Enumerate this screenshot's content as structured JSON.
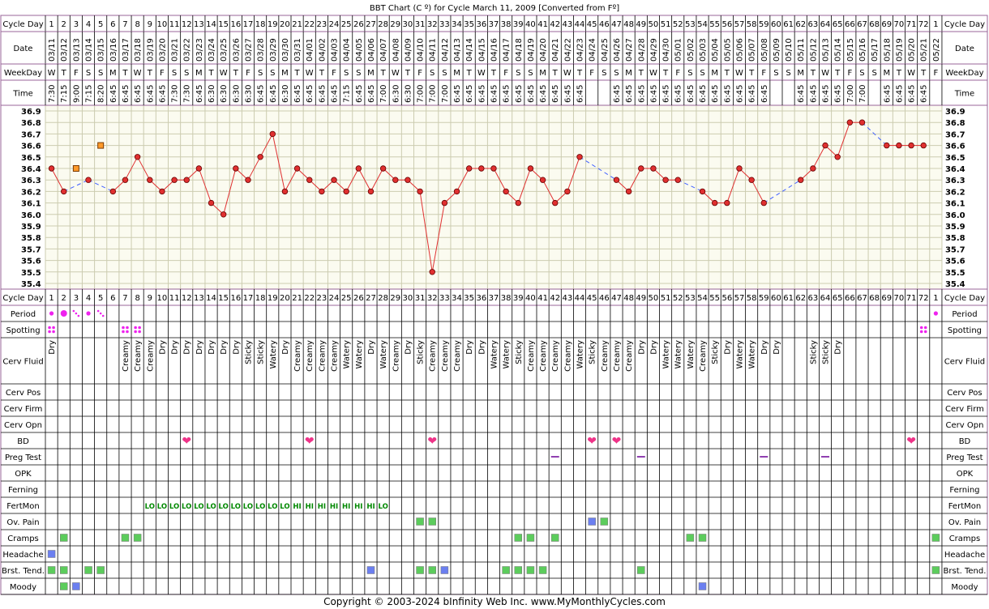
{
  "chart_data": {
    "type": "line",
    "title": "BBT Chart (C º) for Cycle March 11, 2009  [Converted from Fº]",
    "ylim": [
      35.4,
      36.9
    ],
    "yticks": [
      "36.9",
      "36.8",
      "36.7",
      "36.6",
      "36.5",
      "36.4",
      "36.3",
      "36.2",
      "36.1",
      "36.0",
      "35.9",
      "35.8",
      "35.7",
      "35.6",
      "35.5",
      "35.4"
    ],
    "row_labels": {
      "cycle_day": "Cycle Day",
      "date": "Date",
      "weekday": "WeekDay",
      "time": "Time"
    },
    "cycle_days": [
      "1",
      "2",
      "3",
      "4",
      "5",
      "6",
      "7",
      "8",
      "9",
      "10",
      "11",
      "12",
      "13",
      "14",
      "15",
      "16",
      "17",
      "18",
      "19",
      "20",
      "21",
      "22",
      "23",
      "24",
      "25",
      "26",
      "27",
      "28",
      "29",
      "30",
      "31",
      "32",
      "33",
      "34",
      "35",
      "36",
      "37",
      "38",
      "39",
      "40",
      "41",
      "42",
      "43",
      "44",
      "45",
      "46",
      "47",
      "48",
      "49",
      "50",
      "51",
      "52",
      "53",
      "54",
      "55",
      "56",
      "57",
      "58",
      "59",
      "60",
      "61",
      "62",
      "63",
      "64",
      "65",
      "66",
      "67",
      "68",
      "69",
      "70",
      "71",
      "72",
      "1"
    ],
    "dates": [
      "03/11",
      "03/12",
      "03/13",
      "03/14",
      "03/15",
      "03/16",
      "03/17",
      "03/18",
      "03/19",
      "03/20",
      "03/21",
      "03/22",
      "03/23",
      "03/24",
      "03/25",
      "03/26",
      "03/27",
      "03/28",
      "03/29",
      "03/30",
      "03/31",
      "04/01",
      "04/02",
      "04/03",
      "04/04",
      "04/05",
      "04/06",
      "04/07",
      "04/08",
      "04/09",
      "04/10",
      "04/11",
      "04/12",
      "04/13",
      "04/14",
      "04/15",
      "04/16",
      "04/17",
      "04/18",
      "04/19",
      "04/20",
      "04/21",
      "04/22",
      "04/23",
      "04/24",
      "04/25",
      "04/26",
      "04/27",
      "04/28",
      "04/29",
      "04/30",
      "05/01",
      "05/02",
      "05/03",
      "05/04",
      "05/05",
      "05/06",
      "05/07",
      "05/08",
      "05/09",
      "05/10",
      "05/11",
      "05/12",
      "05/13",
      "05/14",
      "05/15",
      "05/16",
      "05/17",
      "05/18",
      "05/19",
      "05/20",
      "05/21",
      "05/22"
    ],
    "weekdays": [
      "W",
      "T",
      "F",
      "S",
      "S",
      "M",
      "T",
      "W",
      "T",
      "F",
      "S",
      "S",
      "M",
      "T",
      "W",
      "T",
      "F",
      "S",
      "S",
      "M",
      "T",
      "W",
      "T",
      "F",
      "S",
      "S",
      "M",
      "T",
      "W",
      "T",
      "F",
      "S",
      "S",
      "M",
      "T",
      "W",
      "T",
      "F",
      "S",
      "S",
      "M",
      "T",
      "W",
      "T",
      "F",
      "S",
      "S",
      "M",
      "T",
      "W",
      "T",
      "F",
      "S",
      "S",
      "M",
      "T",
      "W",
      "T",
      "F",
      "S",
      "S",
      "M",
      "T",
      "W",
      "T",
      "F",
      "S",
      "S",
      "M",
      "T",
      "W",
      "T",
      "F"
    ],
    "times": [
      "7:30",
      "7:15",
      "9:00",
      "7:15",
      "8:20",
      "6:45",
      "6:45",
      "6:45",
      "6:45",
      "6:45",
      "7:30",
      "7:30",
      "6:45",
      "6:30",
      "6:30",
      "6:30",
      "6:30",
      "6:45",
      "6:45",
      "6:30",
      "6:45",
      "6:45",
      "6:45",
      "6:45",
      "7:15",
      "6:45",
      "6:45",
      "7:00",
      "6:30",
      "6:30",
      "7:00",
      "7:00",
      "7:00",
      "6:45",
      "6:45",
      "6:45",
      "6:45",
      "6:45",
      "6:45",
      "6:45",
      "6:45",
      "6:45",
      "6:45",
      "6:45",
      "",
      "",
      "6:45",
      "6:45",
      "6:45",
      "6:45",
      "6:45",
      "6:45",
      "6:45",
      "6:45",
      "6:45",
      "6:45",
      "6:45",
      "6:45",
      "6:45",
      "",
      "",
      "6:45",
      "6:45",
      "6:45",
      "6:45",
      "7:00",
      "7:00",
      "",
      "6:45",
      "6:45",
      "6:45",
      "6:45",
      ""
    ],
    "temps": [
      36.4,
      36.2,
      null,
      36.3,
      null,
      36.2,
      36.3,
      36.5,
      36.3,
      36.2,
      36.3,
      36.3,
      36.4,
      36.1,
      36.0,
      36.4,
      36.3,
      36.5,
      36.7,
      36.2,
      36.4,
      36.3,
      36.2,
      36.3,
      36.2,
      36.4,
      36.2,
      36.4,
      36.3,
      36.3,
      36.2,
      35.5,
      36.1,
      36.2,
      36.4,
      36.4,
      36.4,
      36.2,
      36.1,
      36.4,
      36.3,
      36.1,
      36.2,
      36.5,
      null,
      null,
      36.3,
      36.2,
      36.4,
      36.4,
      36.3,
      36.3,
      null,
      36.2,
      36.1,
      36.1,
      36.4,
      36.3,
      36.1,
      null,
      null,
      36.3,
      36.4,
      36.6,
      36.5,
      36.8,
      36.8,
      null,
      36.6,
      36.6,
      36.6,
      36.6,
      null
    ],
    "discarded": [
      {
        "day_index": 2,
        "value": 36.4
      },
      {
        "day_index": 4,
        "value": 36.6
      }
    ],
    "line_color": "#e03030",
    "interpolated_color": "#4060ff",
    "grid_color": "#ccccb0",
    "plot_bg": "#fbfbf0"
  },
  "rows": [
    {
      "label": "Period",
      "type": "period",
      "cells": {
        "0": "dot",
        "1": "dot-big",
        "2": "drops",
        "3": "dot",
        "4": "drops",
        "72": "dot"
      }
    },
    {
      "label": "Spotting",
      "type": "spot",
      "cells": {
        "0": "spot",
        "6": "spot",
        "7": "spot",
        "71": "spot"
      }
    },
    {
      "label": "Cerv Fluid",
      "type": "text",
      "cells": {
        "0": "Dry",
        "6": "Creamy",
        "7": "Creamy",
        "8": "Creamy",
        "9": "Dry",
        "10": "Dry",
        "11": "Dry",
        "12": "Dry",
        "13": "Dry",
        "14": "Dry",
        "15": "Dry",
        "16": "Sticky",
        "17": "Sticky",
        "18": "Watery",
        "19": "Dry",
        "20": "Creamy",
        "21": "Creamy",
        "22": "Creamy",
        "23": "Creamy",
        "24": "Watery",
        "25": "Watery",
        "26": "Dry",
        "27": "Watery",
        "28": "Creamy",
        "29": "Dry",
        "30": "Sticky",
        "31": "Creamy",
        "32": "Creamy",
        "33": "Creamy",
        "34": "Dry",
        "35": "Dry",
        "36": "Watery",
        "37": "Watery",
        "38": "Sticky",
        "39": "Creamy",
        "40": "Creamy",
        "41": "Creamy",
        "42": "Creamy",
        "43": "Watery",
        "44": "Sticky",
        "45": "Creamy",
        "46": "Creamy",
        "47": "Creamy",
        "48": "Dry",
        "49": "Dry",
        "50": "Watery",
        "51": "Watery",
        "52": "Watery",
        "53": "Creamy",
        "54": "Sticky",
        "55": "Dry",
        "56": "Watery",
        "57": "Watery",
        "58": "Dry",
        "59": "Dry",
        "62": "Sticky",
        "63": "Sticky",
        "64": "Dry"
      }
    },
    {
      "label": "Cerv Pos",
      "type": "none",
      "cells": {}
    },
    {
      "label": "Cerv Firm",
      "type": "none",
      "cells": {}
    },
    {
      "label": "Cerv Opn",
      "type": "none",
      "cells": {}
    },
    {
      "label": "BD",
      "type": "heart",
      "cells": {
        "11": "heart",
        "21": "heart",
        "31": "heart",
        "44": "heart",
        "46": "heart",
        "70": "heart"
      }
    },
    {
      "label": "Preg Test",
      "type": "dash",
      "cells": {
        "41": "dash",
        "48": "dash",
        "58": "dash",
        "63": "dash"
      }
    },
    {
      "label": "OPK",
      "type": "none",
      "cells": {}
    },
    {
      "label": "Ferning",
      "type": "none",
      "cells": {}
    },
    {
      "label": "FertMon",
      "type": "fm",
      "cells": {
        "8": "LO",
        "9": "LO",
        "10": "LO",
        "11": "LO",
        "12": "LO",
        "13": "LO",
        "14": "LO",
        "15": "LO",
        "16": "LO",
        "17": "LO",
        "18": "LO",
        "19": "LO",
        "20": "HI",
        "21": "HI",
        "22": "HI",
        "23": "HI",
        "24": "HI",
        "25": "HI",
        "26": "HI",
        "27": "LO"
      }
    },
    {
      "label": "Ov. Pain",
      "type": "box",
      "cells": {
        "30": "g",
        "31": "g",
        "44": "b",
        "45": "g"
      }
    },
    {
      "label": "Cramps",
      "type": "box",
      "cells": {
        "1": "g",
        "6": "g",
        "7": "g",
        "38": "g",
        "39": "g",
        "41": "g",
        "52": "g",
        "53": "g",
        "72": "g"
      }
    },
    {
      "label": "Headache",
      "type": "box",
      "cells": {
        "0": "b"
      }
    },
    {
      "label": "Brst. Tend.",
      "type": "box",
      "cells": {
        "0": "g",
        "1": "g",
        "3": "g",
        "4": "g",
        "26": "b",
        "30": "g",
        "31": "g",
        "32": "b",
        "37": "g",
        "38": "g",
        "39": "g",
        "40": "g",
        "48": "g",
        "72": "g"
      }
    },
    {
      "label": "Moody",
      "type": "box",
      "cells": {
        "1": "g",
        "2": "b",
        "53": "b"
      }
    }
  ],
  "colors": {
    "green": "#5ccc5c",
    "blue": "#6b7ff0",
    "pink": "#ee3388",
    "magenta": "#ee22ee",
    "purple": "#9040b0",
    "fm_text": "#008800",
    "frame": "#996699"
  },
  "footer": "Copyright © 2003-2024 bInfinity Web Inc.     www.MyMonthlyCycles.com"
}
